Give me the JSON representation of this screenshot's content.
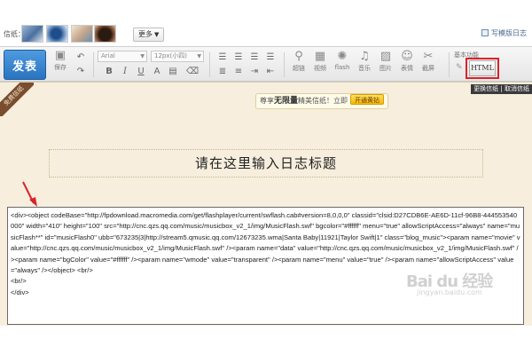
{
  "themes": {
    "label": "信纸：",
    "more_label": "更多",
    "save_status": "写模版日志"
  },
  "toolbar": {
    "publish_label": "发表",
    "save_label": "保存",
    "undo_label": "撤销",
    "font_name": "Arial",
    "font_size": "12px(小四)",
    "tools": [
      "超链",
      "视频",
      "flash",
      "音乐",
      "图片",
      "表情",
      "截屏"
    ],
    "basic_func_label": "基本功能",
    "html_label": "HTML"
  },
  "change_bar": {
    "links": "更换信纸 | 取消信纸"
  },
  "editor": {
    "ribbon_label": "免费信纸",
    "promo_prefix": "尊享",
    "promo_bold": "无限量",
    "promo_suffix": "精美信纸！立即",
    "promo_button": "开通黄钻",
    "title_placeholder": "请在这里输入日志标题",
    "code_lines": [
      "<div><object codeBase=\"http://fpdownload.macromedia.com/get/flashplayer/current/swflash.cab#version=8,0,0,0\" classid=\"clsid:D27CDB6E-AE6D-11cf-96B8-444553540000\" width=\"410\" height=\"100\" src=\"http://cnc.qzs.qq.com/music/musicbox_v2_1/img/MusicFlash.swf\" bgcolor=\"#ffffff\" menu=\"true\" allowScriptAccess=\"always\" name=\"musicFlash**\" id=\"musicFlash0\" ubb=\"673235|3|http://stream5.qmusic.qq.com/12673235.wma|Santa Baby|11921|Taylor Swift|1\" class=\"blog_music\"><param name=\"movie\" value=\"http://cnc.qzs.qq.com/music/musicbox_v2_1/img/MusicFlash.swf\" /><param name=\"data\" value=\"http://cnc.qzs.qq.com/music/musicbox_v2_1/img/MusicFlash.swf\" /><param name=\"bgColor\" value=\"#ffffff\" /><param name=\"wmode\" value=\"transparent\" /><param name=\"menu\" value=\"true\" /><param name=\"allowScriptAccess\" value=\"always\" /></object> <br/>",
      "<br/>",
      "</div>"
    ]
  },
  "watermark": {
    "text": "Bai du 经验",
    "sub": "jingyan.baidu.com"
  },
  "colors": {
    "publish_bg": "#2a73c0",
    "editor_bg": "#f7eedd",
    "highlight_red": "#d8232a",
    "ribbon_brown": "#7a4d2e"
  }
}
